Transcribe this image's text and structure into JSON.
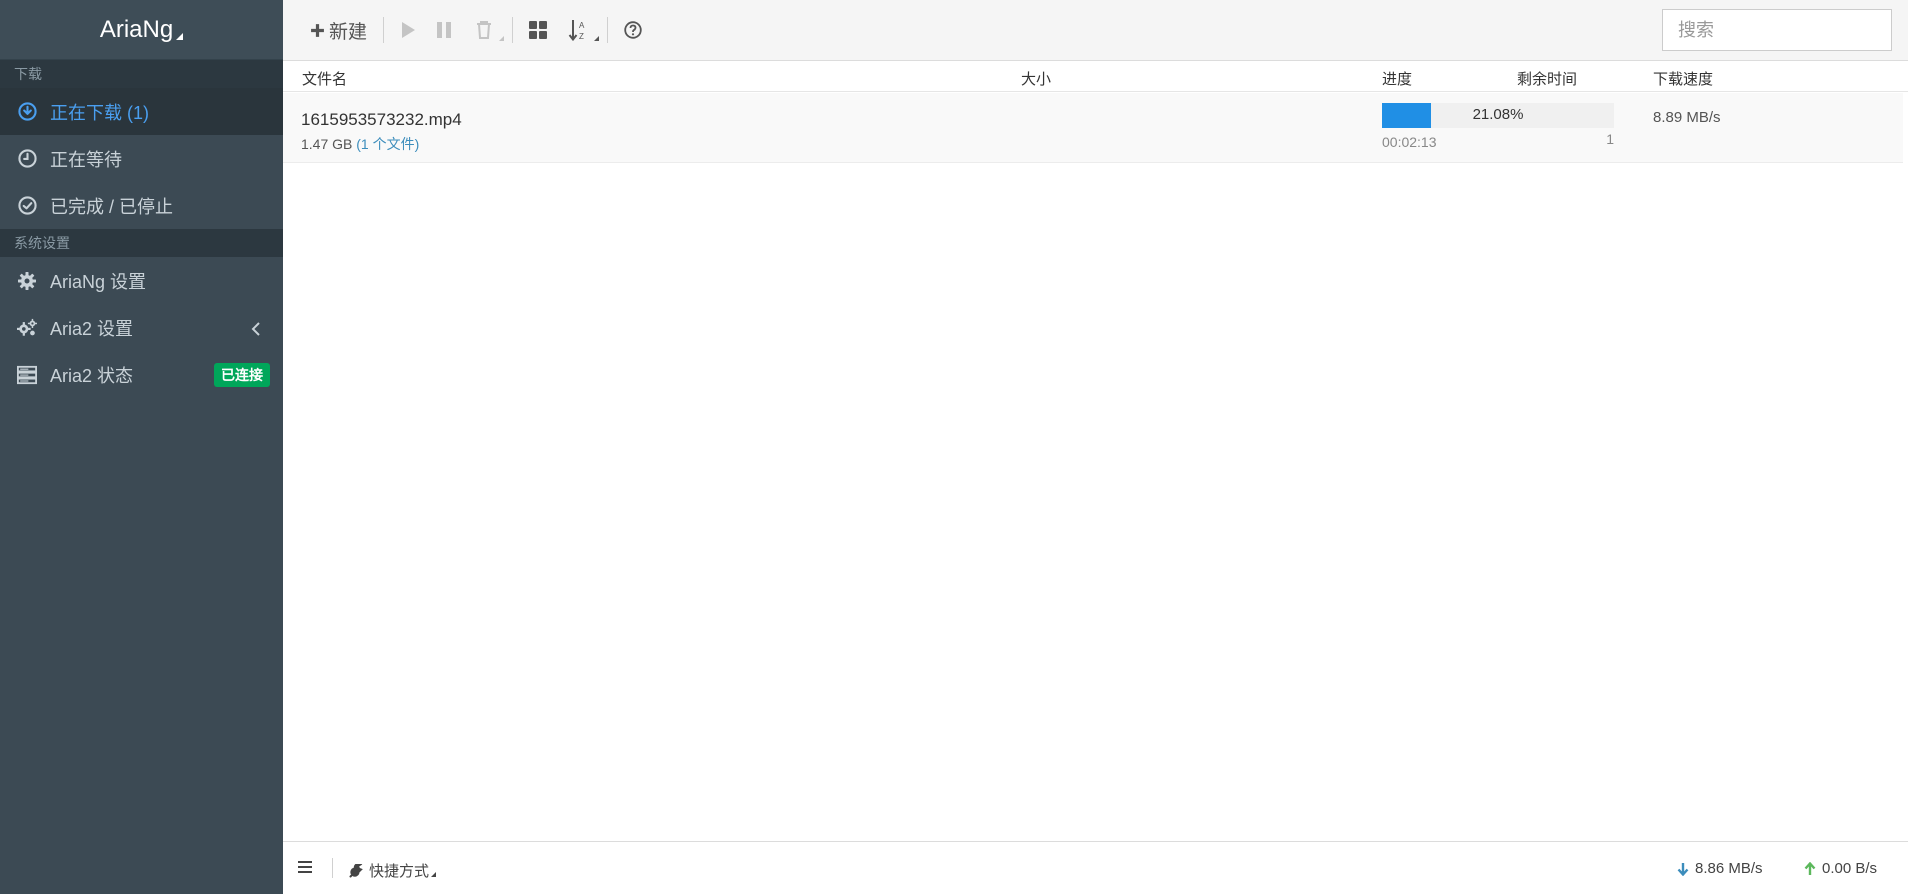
{
  "app": {
    "title": "AriaNg"
  },
  "sidebar": {
    "sections": [
      {
        "header": "下载",
        "items": [
          {
            "label": "正在下载 (1)",
            "icon": "download-circle-icon",
            "active": true
          },
          {
            "label": "正在等待",
            "icon": "clock-icon",
            "active": false
          },
          {
            "label": "已完成 / 已停止",
            "icon": "check-circle-icon",
            "active": false
          }
        ]
      },
      {
        "header": "系统设置",
        "items": [
          {
            "label": "AriaNg 设置",
            "icon": "gear-icon"
          },
          {
            "label": "Aria2 设置",
            "icon": "gears-icon",
            "chevron": "chevron-left-icon"
          },
          {
            "label": "Aria2 状态",
            "icon": "server-icon",
            "badge": "已连接"
          }
        ]
      }
    ],
    "badge_color": "#00a65a",
    "active_color": "#4a9ff0"
  },
  "toolbar": {
    "new_label": "新建",
    "search": {
      "placeholder": "搜索",
      "value": ""
    }
  },
  "table": {
    "headers": {
      "name": "文件名",
      "size": "大小",
      "progress": "进度",
      "remaining": "剩余时间",
      "speed": "下载速度"
    },
    "rows": [
      {
        "name": "1615953573232.mp4",
        "size": "1.47 GB",
        "files": "(1 个文件)",
        "progress_value": 21.08,
        "progress_text": "21.08%",
        "remaining": "00:02:13",
        "connections": "1",
        "speed": "8.89 MB/s"
      }
    ]
  },
  "footer": {
    "shortcut_label": "快捷方式",
    "download_speed": "8.86 MB/s",
    "upload_speed": "0.00 B/s",
    "download_arrow_color": "#3c8dbc",
    "upload_arrow_color": "#5cb85c"
  },
  "colors": {
    "sidebar_bg": "#3c4a54",
    "progress_fill": "#208fe5"
  }
}
